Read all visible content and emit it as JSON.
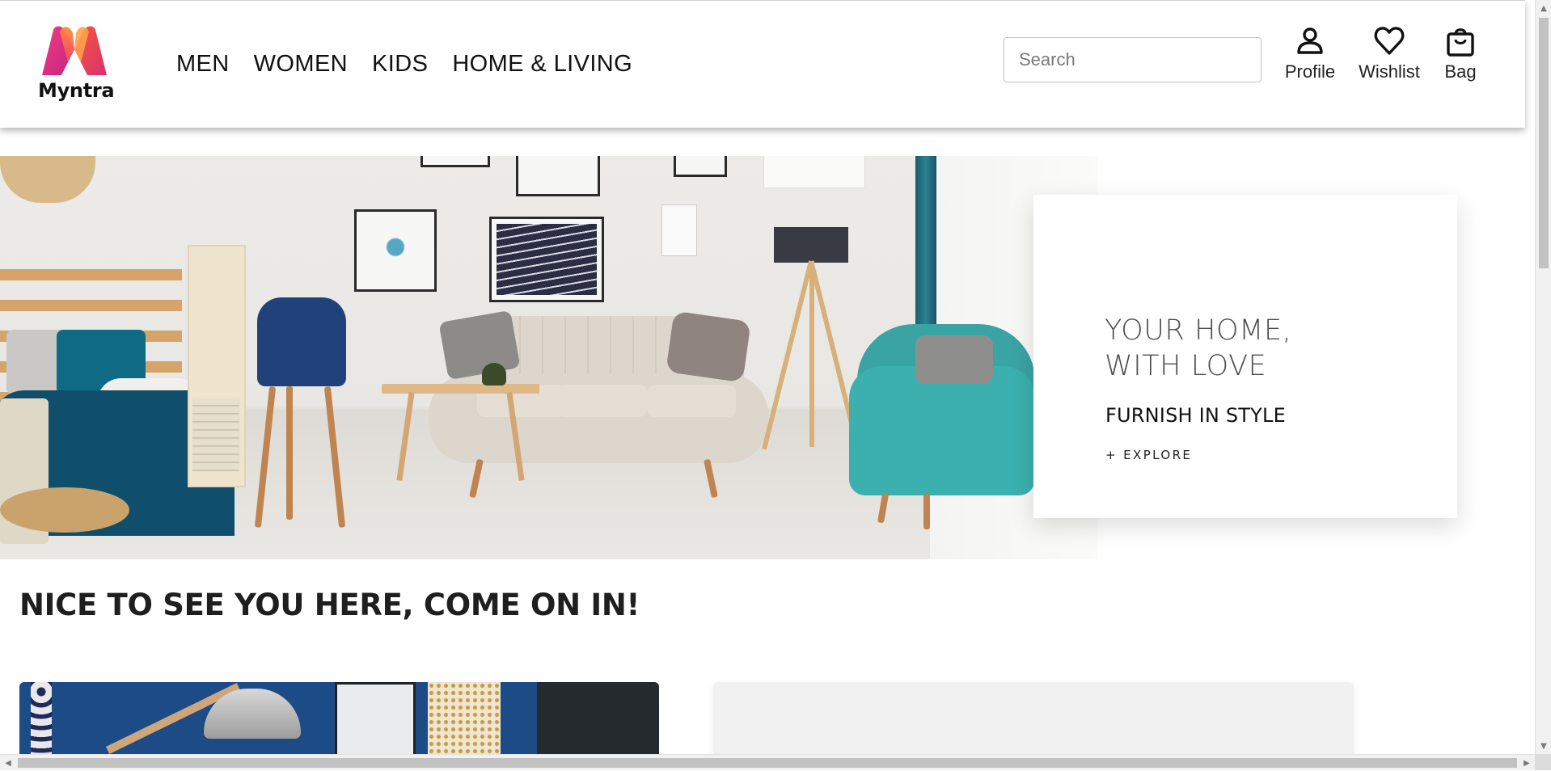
{
  "brand": {
    "name": "Myntra",
    "logo_colors": [
      "#ff3f6c",
      "#f96c2e",
      "#ff9a3c",
      "#d63384",
      "#7b2cbf"
    ]
  },
  "nav": {
    "items": [
      {
        "label": "MEN"
      },
      {
        "label": "WOMEN"
      },
      {
        "label": "KIDS"
      },
      {
        "label": "HOME & LIVING"
      }
    ]
  },
  "search": {
    "placeholder": "Search",
    "value": ""
  },
  "actions": {
    "profile": {
      "label": "Profile",
      "icon": "user-icon"
    },
    "wishlist": {
      "label": "Wishlist",
      "icon": "heart-icon"
    },
    "bag": {
      "label": "Bag",
      "icon": "shopping-bag-icon"
    }
  },
  "hero": {
    "image": "living-room-interior",
    "title": "YOUR HOME,\nWITH LOVE",
    "subtitle": "FURNISH IN STYLE",
    "cta": "+ EXPLORE"
  },
  "welcome": {
    "text": "NICE TO SEE YOU HERE, COME ON IN!"
  },
  "tiles": [
    {
      "image": "blue-wall-lamp-interior"
    },
    {
      "image": "light-grey-interior"
    }
  ],
  "colors": {
    "accent_pink": "#ff3f6c",
    "text_dark": "#1f1f1f",
    "teal_armchair": "#3bb0ae",
    "navy_wall": "#1c4b86"
  }
}
